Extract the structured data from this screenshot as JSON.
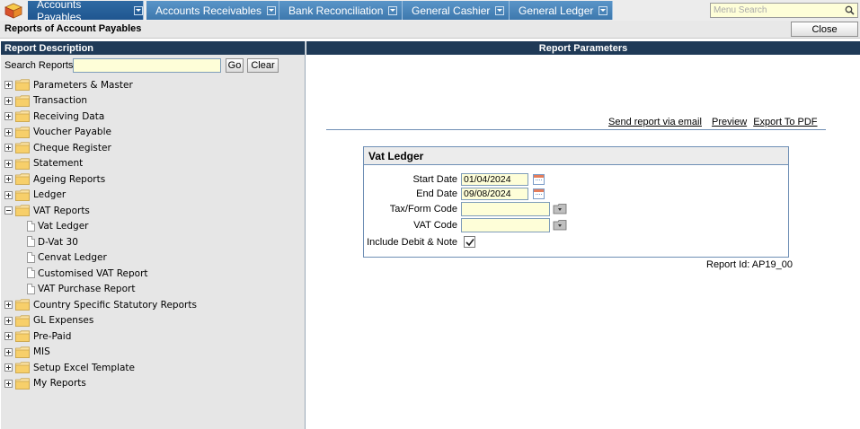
{
  "nav": {
    "tabs": [
      {
        "label": "Accounts Payables",
        "active": true
      },
      {
        "label": "Accounts Receivables",
        "active": false
      },
      {
        "label": "Bank Reconciliation",
        "active": false
      },
      {
        "label": "General Cashier",
        "active": false
      },
      {
        "label": "General Ledger",
        "active": false
      }
    ],
    "menu_search_placeholder": "Menu Search"
  },
  "header": {
    "title": "Reports of Account Payables",
    "close_label": "Close"
  },
  "left_panel": {
    "header": "Report Description",
    "search_label": "Search Reports",
    "search_value": "",
    "go_label": "Go",
    "clear_label": "Clear",
    "tree": [
      {
        "label": "Parameters & Master",
        "type": "folder",
        "expanded": false
      },
      {
        "label": "Transaction",
        "type": "folder",
        "expanded": false
      },
      {
        "label": "Receiving Data",
        "type": "folder",
        "expanded": false
      },
      {
        "label": "Voucher Payable",
        "type": "folder",
        "expanded": false
      },
      {
        "label": "Cheque Register",
        "type": "folder",
        "expanded": false
      },
      {
        "label": "Statement",
        "type": "folder",
        "expanded": false
      },
      {
        "label": "Ageing Reports",
        "type": "folder",
        "expanded": false
      },
      {
        "label": "Ledger",
        "type": "folder",
        "expanded": false
      },
      {
        "label": "VAT Reports",
        "type": "folder",
        "expanded": true
      },
      {
        "label": "Vat Ledger",
        "type": "report"
      },
      {
        "label": "D-Vat 30",
        "type": "report"
      },
      {
        "label": "Cenvat Ledger",
        "type": "report"
      },
      {
        "label": "Customised VAT Report",
        "type": "report"
      },
      {
        "label": "VAT Purchase Report",
        "type": "report"
      },
      {
        "label": "Country Specific Statutory Reports",
        "type": "folder",
        "expanded": false
      },
      {
        "label": "GL Expenses",
        "type": "folder",
        "expanded": false
      },
      {
        "label": "Pre-Paid",
        "type": "folder",
        "expanded": false
      },
      {
        "label": "MIS",
        "type": "folder",
        "expanded": false
      },
      {
        "label": "Setup Excel Template",
        "type": "folder",
        "expanded": false
      },
      {
        "label": "My Reports",
        "type": "folder",
        "expanded": false
      }
    ]
  },
  "right_panel": {
    "header": "Report Parameters",
    "links": {
      "email": "Send report via email",
      "preview": "Preview",
      "pdf": "Export To PDF"
    },
    "form": {
      "title": "Vat Ledger",
      "start_date_label": "Start Date",
      "start_date_value": "01/04/2024",
      "end_date_label": "End Date",
      "end_date_value": "09/08/2024",
      "tax_form_label": "Tax/Form Code",
      "tax_form_value": "",
      "vat_code_label": "VAT Code",
      "vat_code_value": "",
      "include_label": "Include Debit & Note",
      "include_checked": true
    },
    "report_id": "Report Id: AP19_00"
  },
  "colors": {
    "nav_active": "#2f6aa3",
    "nav_tab": "#4a86bb",
    "panel_header": "#1f3a57",
    "input_bg": "#fefed8"
  }
}
